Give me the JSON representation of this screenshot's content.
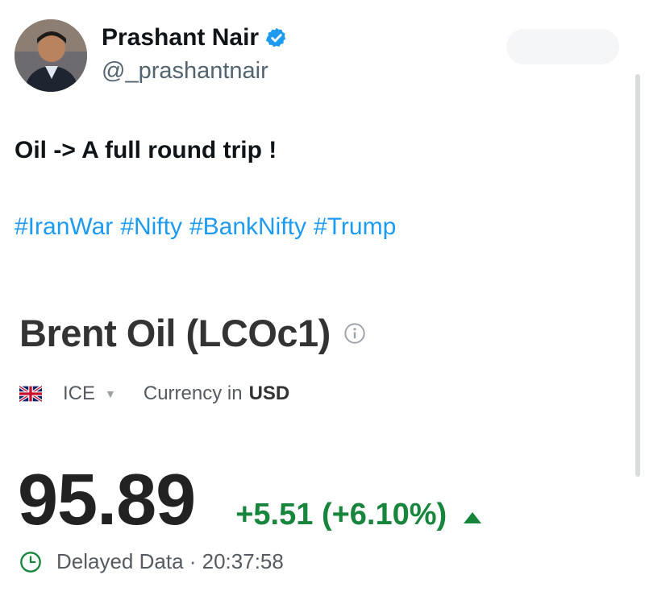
{
  "tweet": {
    "author_name": "Prashant Nair",
    "handle": "@_prashantnair",
    "text": "Oil -> A full round trip !",
    "hashtags": [
      "#IranWar",
      "#Nifty",
      "#BankNifty",
      "#Trump"
    ],
    "verified": true
  },
  "quote": {
    "title": "Brent Oil (LCOc1)",
    "exchange": "ICE",
    "currency_label": "Currency in",
    "currency": "USD",
    "price": "95.89",
    "change": "+5.51 (+6.10%)",
    "status": "Delayed Data · 20:37:58"
  },
  "colors": {
    "link": "#1d9bf0",
    "verified": "#1d9bf0",
    "positive": "#17853b"
  },
  "icons": [
    "verified-badge-icon",
    "info-icon",
    "uk-flag-icon",
    "chevron-down-icon",
    "up-arrow-icon",
    "clock-icon"
  ]
}
